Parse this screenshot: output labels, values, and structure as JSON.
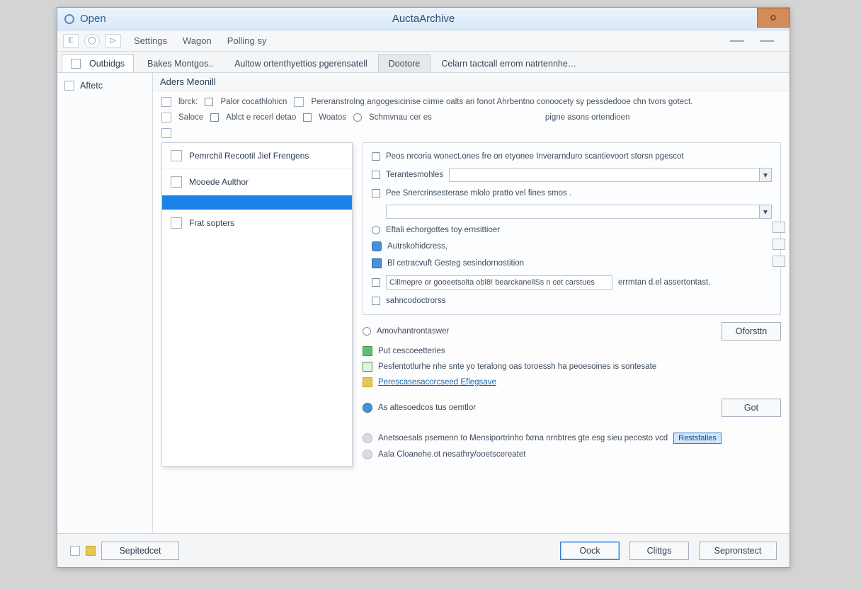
{
  "titlebar": {
    "open": "Open",
    "center": "AuctaArchive"
  },
  "toolbar": {
    "icon1": "E",
    "icon2": "◯",
    "icon3": "▷",
    "menu1": "Settings",
    "menu2": "Wagon",
    "menu3": "Polling sy"
  },
  "tabs": {
    "side": "Outbidgs",
    "t1": "Bakes Montgos..",
    "t2": "Aultow ortenthyettios pgerensatell",
    "t3": "Dootore",
    "t4": "Celarn tactcall errom natrtennhe…"
  },
  "sidebar": {
    "item1": "Aftetc"
  },
  "section": {
    "title": "Aders Meonill"
  },
  "topopts": {
    "r1a": "lbrck:",
    "r1b": "Palor cocathlohicn",
    "r1c": "Pereranstrolng angogesicinise ciimie oalts ari fonot Ahrbentno conoocety sy pessdedooe chn tvors gotect.",
    "r2a": "Saloce",
    "r2b": "Ablct e recerl detao",
    "r2c": "Woatos",
    "r2d": "Schmvnau cer es",
    "r2e": "pigne asons ortendioen"
  },
  "leftlist": {
    "i1": "Pemrchil Recootil Jief Frengens",
    "i2": "Mooede Aulthor",
    "i3": "",
    "i4": "Frat sopters"
  },
  "panel": {
    "top": "Peos nrcoria wonect.ones fre on etyonee Inverarnduro scantievoort storsn pgescot",
    "lab1": "Terantesmohles",
    "lab2": "Pee Snercrinsesterase mlolo pratto vel fines smos .",
    "radio1": "Eftali echorgottes toy ernsittioer",
    "h1": "Autrskohidcress,",
    "h2": "Bl cetracvuft Gesteg sesindornostition",
    "boxed": "Cillmepre or gooeetsolta obl8! bearckanellSs n cet carstues",
    "after_boxed": "errmtan d.el assertontast.",
    "h2b": "sahncodoctrorss"
  },
  "below": {
    "r1": "Amovhantrontaswer",
    "r2": "Put cescoeetteries",
    "r3": "Pesfentotlurhe nhe snte yo teralong oas toroessh ha peoesoines is sontesate",
    "r4": "Perescasesacorcseed Eflegsave",
    "r5": "As altesoedcos tus oemtlor",
    "r6": "Anetsoesals psemenn to Mensiportrinho fxrna nrnbtres gte esg sieu pecosto vcd",
    "r6_badge": "Restsfalles",
    "r7": "Aala Cloanehe.ot nesathry/ooetscereatet"
  },
  "buttons": {
    "options": "Oforsttn",
    "go": "Got",
    "ok": "Oock",
    "close": "Clittgs",
    "apply": "Sepronstect",
    "footer_left": "Sepitedcet"
  }
}
